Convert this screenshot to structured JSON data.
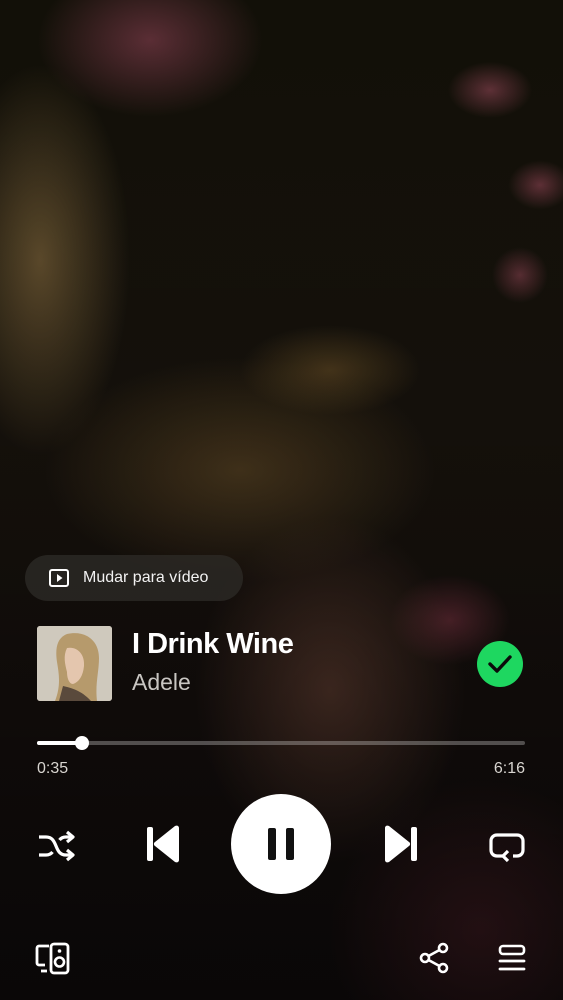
{
  "switch_video": {
    "label": "Mudar para vídeo",
    "icon": "play-square-icon"
  },
  "track": {
    "title": "I Drink Wine",
    "artist": "Adele",
    "saved": true
  },
  "progress": {
    "elapsed": "0:35",
    "total": "6:16",
    "fraction": 0.093
  },
  "controls": {
    "shuffle_icon": "shuffle-icon",
    "previous_icon": "skip-previous-icon",
    "play_state_icon": "pause-icon",
    "next_icon": "skip-next-icon",
    "repeat_icon": "repeat-icon"
  },
  "bottom_bar": {
    "devices_icon": "connect-devices-icon",
    "share_icon": "share-icon",
    "queue_icon": "queue-icon"
  },
  "colors": {
    "accent": "#1ed760",
    "text_primary": "#ffffff",
    "text_secondary": "#c9c6c2"
  }
}
